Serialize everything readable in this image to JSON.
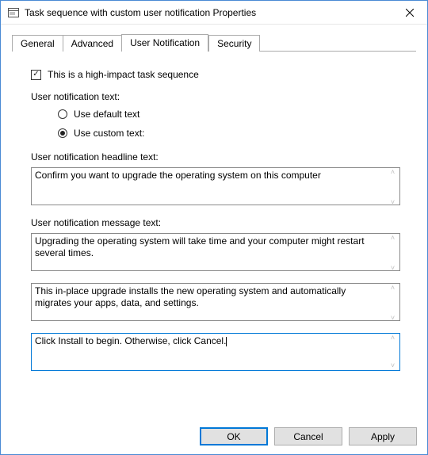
{
  "window": {
    "title": "Task sequence with custom user notification Properties"
  },
  "tabs": {
    "general": "General",
    "advanced": "Advanced",
    "user_notification": "User Notification",
    "security": "Security",
    "active": "user_notification"
  },
  "panel": {
    "high_impact_label": "This is a high-impact task sequence",
    "notification_text_label": "User notification text:",
    "radio_default": "Use default text",
    "radio_custom": "Use custom text:",
    "headline_label": "User notification headline text:",
    "headline_value": "Confirm you want to upgrade the operating system on this computer",
    "message_label": "User notification message text:",
    "message1": "Upgrading the operating system will take time and your computer might restart several times.",
    "message2": "This in-place upgrade installs the new operating system and automatically migrates your apps, data, and settings.",
    "message3": "Click Install to begin. Otherwise, click Cancel."
  },
  "buttons": {
    "ok": "OK",
    "cancel": "Cancel",
    "apply": "Apply"
  }
}
